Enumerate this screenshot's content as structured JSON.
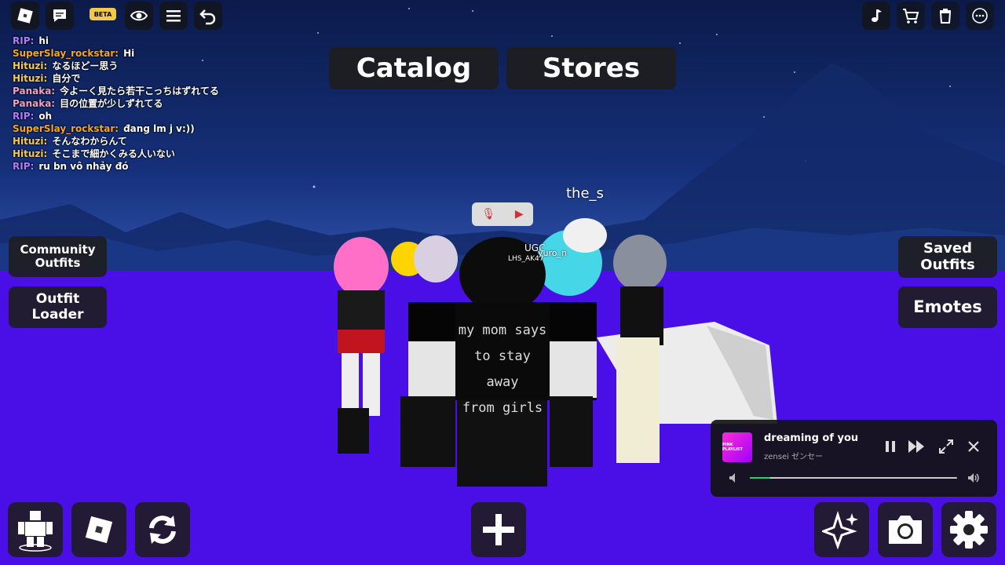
{
  "topbar": {
    "left_icons": [
      "roblox-logo-icon",
      "chat-icon",
      "beta-badge",
      "eye-icon",
      "menu-icon",
      "undo-icon"
    ],
    "beta_label": "BETA",
    "right_icons": [
      "music-note-icon",
      "cart-icon",
      "trash-icon",
      "more-icon"
    ]
  },
  "chat": {
    "messages": [
      {
        "name": "RIP:",
        "text": "hi",
        "color": "#b07cff"
      },
      {
        "name": "SuperSlay_rockstar:",
        "text": "Hi",
        "color": "#f5a623"
      },
      {
        "name": "Hituzi:",
        "text": "なるほどー思う",
        "color": "#f7c948"
      },
      {
        "name": "Hituzi:",
        "text": "自分で",
        "color": "#f7c948"
      },
      {
        "name": "Panaka:",
        "text": "今よーく見たら若干こっちはずれてる",
        "color": "#f0a0c0"
      },
      {
        "name": "Panaka:",
        "text": "目の位置が少しずれてる",
        "color": "#f0a0c0"
      },
      {
        "name": "RIP:",
        "text": "oh",
        "color": "#b07cff"
      },
      {
        "name": "SuperSlay_rockstar:",
        "text": "đang lm j v:))",
        "color": "#f5a623"
      },
      {
        "name": "Hituzi:",
        "text": "そんなわからんて",
        "color": "#f7c948"
      },
      {
        "name": "Hituzi:",
        "text": "そこまで細かくみる人いない",
        "color": "#f7c948"
      },
      {
        "name": "RIP:",
        "text": "ru bn vô nhảy đó",
        "color": "#b07cff"
      }
    ]
  },
  "top_buttons": {
    "catalog": "Catalog",
    "stores": "Stores"
  },
  "left_buttons": {
    "community_outfits": [
      "Community",
      "Outfits"
    ],
    "outfit_loader": [
      "Outfit",
      "Loader"
    ]
  },
  "right_buttons": {
    "saved_outfits": [
      "Saved",
      "Outfits"
    ],
    "emotes": "Emotes"
  },
  "nametags": {
    "main": "the_s",
    "ugc": "UGC",
    "lhs": "LHS_AK47",
    "yuro": "yuro_n"
  },
  "shirt_text": [
    "my mom says",
    "to stay away",
    "from girls"
  ],
  "music_player": {
    "title": "dreaming of you",
    "artist": "zensei ゼンセー",
    "cover_label": "PINK PLAYLIST",
    "progress": 0.1,
    "progress_color": "#2bd46b"
  },
  "bottom_left_icons": [
    "avatar-icon",
    "roblox-icon",
    "refresh-icon"
  ],
  "bottom_center_icon": "plus-icon",
  "bottom_right_icons": [
    "sparkle-icon",
    "camera-icon",
    "settings-icon"
  ]
}
